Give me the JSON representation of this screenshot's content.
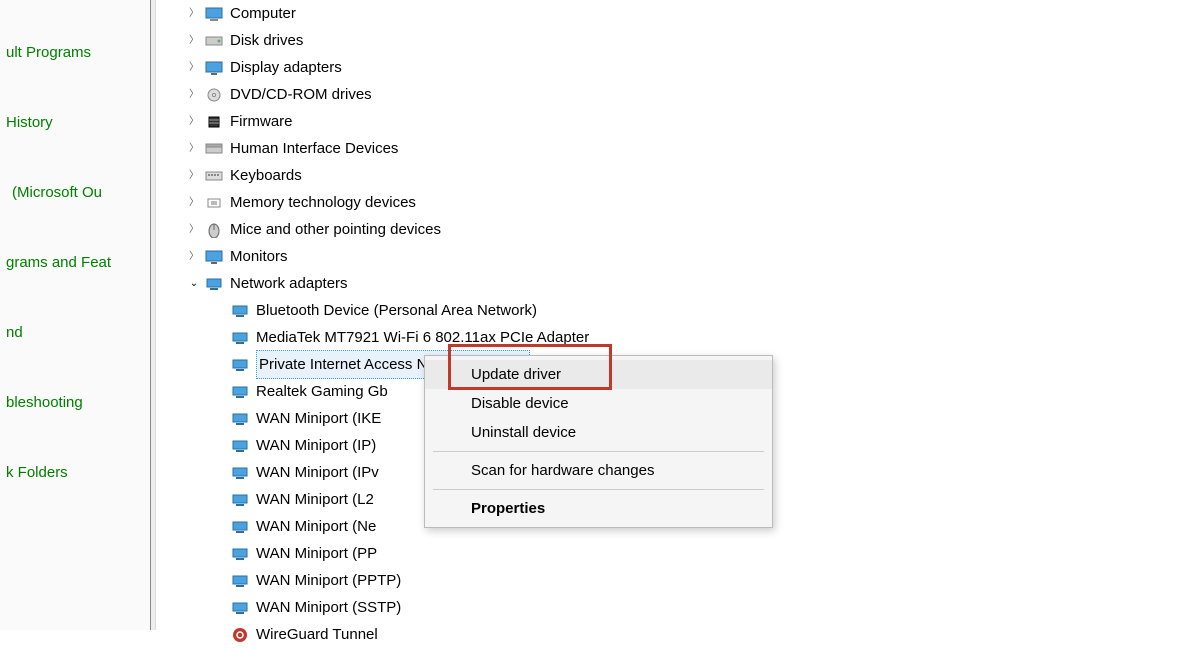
{
  "left_panel": {
    "links": [
      "ult Programs",
      "History",
      " (Microsoft Ou",
      "grams and Feat",
      "nd",
      "bleshooting",
      "k Folders"
    ]
  },
  "tree": {
    "categories": [
      {
        "label": "Computer",
        "icon": "computer-icon"
      },
      {
        "label": "Disk drives",
        "icon": "disk-icon"
      },
      {
        "label": "Display adapters",
        "icon": "display-icon"
      },
      {
        "label": "DVD/CD-ROM drives",
        "icon": "dvd-icon"
      },
      {
        "label": "Firmware",
        "icon": "firmware-icon"
      },
      {
        "label": "Human Interface Devices",
        "icon": "hid-icon"
      },
      {
        "label": "Keyboards",
        "icon": "keyboard-icon"
      },
      {
        "label": "Memory technology devices",
        "icon": "memory-icon"
      },
      {
        "label": "Mice and other pointing devices",
        "icon": "mouse-icon"
      },
      {
        "label": "Monitors",
        "icon": "monitor-icon"
      },
      {
        "label": "Network adapters",
        "icon": "network-icon",
        "expanded": true
      }
    ],
    "network_children": [
      "Bluetooth Device (Personal Area Network)",
      "MediaTek MT7921 Wi-Fi 6 802.11ax PCIe Adapter",
      "Private Internet Access Network Adapter",
      "Realtek Gaming Gb",
      "WAN Miniport (IKE",
      "WAN Miniport (IP)",
      "WAN Miniport (IPv",
      "WAN Miniport (L2",
      "WAN Miniport (Ne",
      "WAN Miniport (PP",
      "WAN Miniport (PPTP)",
      "WAN Miniport (SSTP)",
      "WireGuard Tunnel"
    ],
    "selected_index": 2
  },
  "context_menu": {
    "items": [
      {
        "label": "Update driver",
        "highlighted": true
      },
      {
        "label": "Disable device"
      },
      {
        "label": "Uninstall device"
      },
      {
        "sep": true
      },
      {
        "label": "Scan for hardware changes"
      },
      {
        "sep": true
      },
      {
        "label": "Properties",
        "bold": true
      }
    ]
  }
}
